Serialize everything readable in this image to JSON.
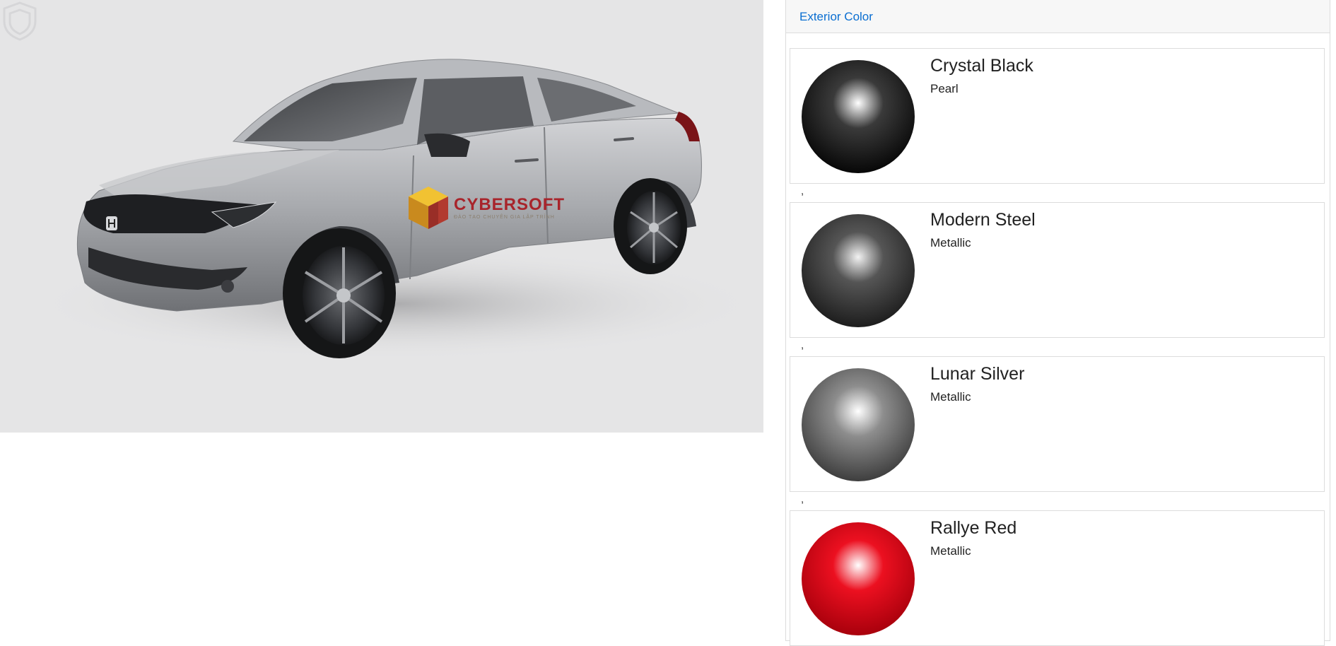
{
  "panel": {
    "tab_label": "Exterior Color",
    "separator": ","
  },
  "vehicle": {
    "badge_icon": "honda-logo-icon",
    "paint_color": "#a9abaf"
  },
  "watermark": {
    "brand_name": "CYBERSOFT",
    "tagline": "ĐÀO TẠO CHUYÊN GIA LẬP TRÌNH",
    "cube_colors": [
      "#f1c232",
      "#c98a1e",
      "#b23a2f"
    ],
    "shield_icon": "shield-watermark-icon"
  },
  "colors": [
    {
      "name": "Crystal Black",
      "finish": "Pearl",
      "base": "#070707",
      "mid": "#3a3a3a",
      "highlight": "#ffffff"
    },
    {
      "name": "Modern Steel",
      "finish": "Metallic",
      "base": "#1d1d1d",
      "mid": "#555555",
      "highlight": "#f2f2f2"
    },
    {
      "name": "Lunar Silver",
      "finish": "Metallic",
      "base": "#3e3e3e",
      "mid": "#8d8d8d",
      "highlight": "#ffffff"
    },
    {
      "name": "Rallye Red",
      "finish": "Metallic",
      "base": "#a8000c",
      "mid": "#ec1020",
      "highlight": "#ffffff"
    }
  ]
}
